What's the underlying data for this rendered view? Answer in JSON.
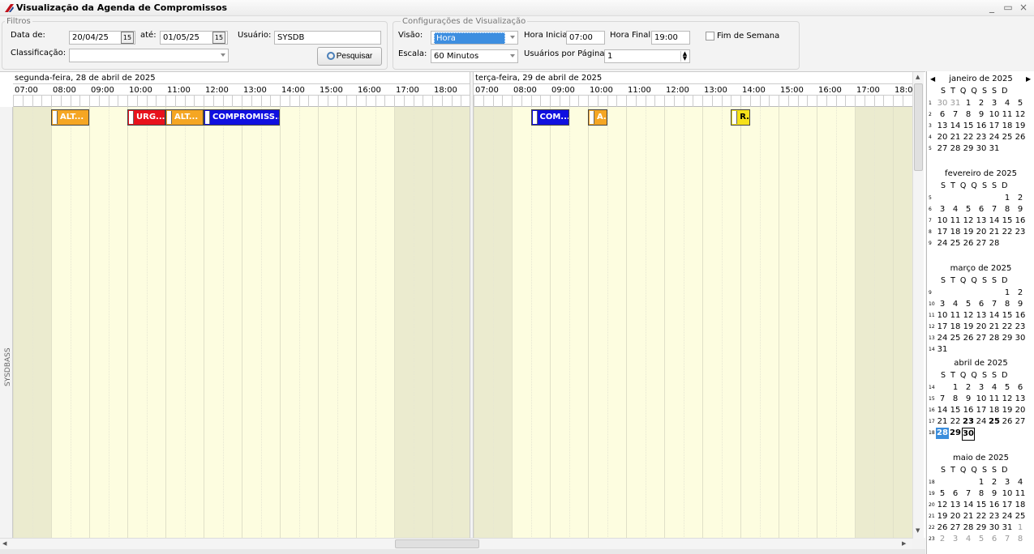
{
  "window": {
    "title": "Visualização da Agenda de Compromissos",
    "min": "_",
    "max": "▭",
    "close": "×"
  },
  "filters": {
    "legend": "Filtros",
    "date_from_label": "Data de:",
    "date_from": "20/04/25",
    "date_to_label": "até:",
    "date_to": "01/05/25",
    "user_label": "Usuário:",
    "user": "SYSDB",
    "class_label": "Classificação:",
    "class_value": "",
    "search_label": "Pesquisar",
    "cal_glyph": "15"
  },
  "view_config": {
    "legend": "Configurações de Visualização",
    "view_label": "Visão:",
    "view_value": "Hora",
    "scale_label": "Escala:",
    "scale_value": "60 Minutos",
    "start_label": "Hora Inicial",
    "start_value": "07:00",
    "end_label": "Hora Final",
    "end_value": "19:00",
    "users_per_page_label": "Usuários por Página",
    "users_per_page_value": "1",
    "weekend_label": "Fim de Semana"
  },
  "scheduler": {
    "resource": "SYSDBASS",
    "hours": [
      "07:00",
      "08:00",
      "09:00",
      "10:00",
      "11:00",
      "12:00",
      "13:00",
      "14:00",
      "15:00",
      "16:00",
      "17:00",
      "18:00"
    ],
    "day2_last_hour": "18:0",
    "days": [
      {
        "label": "segunda-feira, 28 de abril de 2025",
        "appointments": [
          {
            "text": "ALT...",
            "start": 8.0,
            "end": 9.0,
            "color": "#f5a623"
          },
          {
            "text": "URG...",
            "start": 10.0,
            "end": 11.0,
            "color": "#e8121c"
          },
          {
            "text": "ALT...",
            "start": 11.0,
            "end": 12.0,
            "color": "#f5a623"
          },
          {
            "text": "COMPROMISS...",
            "start": 12.0,
            "end": 14.0,
            "color": "#1010e0"
          }
        ]
      },
      {
        "label": "terça-feira, 29 de abril de 2025",
        "appointments": [
          {
            "text": "COM...",
            "start": 8.5,
            "end": 9.5,
            "color": "#1010e0"
          },
          {
            "text": "A.",
            "start": 10.0,
            "end": 10.5,
            "color": "#f5a623"
          },
          {
            "text": "R.",
            "start": 13.75,
            "end": 14.25,
            "color": "#f6e11a"
          }
        ]
      }
    ]
  },
  "calendar": {
    "nav_prev": "◀",
    "nav_next": "▶",
    "weekday_header": "S  T  Q  Q  S  S  D",
    "months": [
      {
        "title": "janeiro de 2025",
        "weeks": [
          {
            "n": "1",
            "d": [
              "30",
              "31",
              "1",
              "2",
              "3",
              "4",
              "5"
            ],
            "o": [
              0,
              1
            ]
          },
          {
            "n": "2",
            "d": [
              "6",
              "7",
              "8",
              "9",
              "10",
              "11",
              "12"
            ]
          },
          {
            "n": "3",
            "d": [
              "13",
              "14",
              "15",
              "16",
              "17",
              "18",
              "19"
            ]
          },
          {
            "n": "4",
            "d": [
              "20",
              "21",
              "22",
              "23",
              "24",
              "25",
              "26"
            ]
          },
          {
            "n": "5",
            "d": [
              "27",
              "28",
              "29",
              "30",
              "31",
              "",
              ""
            ]
          }
        ]
      },
      {
        "title": "fevereiro de 2025",
        "weeks": [
          {
            "n": "5",
            "d": [
              "",
              "",
              "",
              "",
              "",
              "1",
              "2"
            ]
          },
          {
            "n": "6",
            "d": [
              "3",
              "4",
              "5",
              "6",
              "7",
              "8",
              "9"
            ]
          },
          {
            "n": "7",
            "d": [
              "10",
              "11",
              "12",
              "13",
              "14",
              "15",
              "16"
            ]
          },
          {
            "n": "8",
            "d": [
              "17",
              "18",
              "19",
              "20",
              "21",
              "22",
              "23"
            ]
          },
          {
            "n": "9",
            "d": [
              "24",
              "25",
              "26",
              "27",
              "28",
              "",
              ""
            ]
          }
        ]
      },
      {
        "title": "março de 2025",
        "weeks": [
          {
            "n": "9",
            "d": [
              "",
              "",
              "",
              "",
              "",
              "1",
              "2"
            ]
          },
          {
            "n": "10",
            "d": [
              "3",
              "4",
              "5",
              "6",
              "7",
              "8",
              "9"
            ]
          },
          {
            "n": "11",
            "d": [
              "10",
              "11",
              "12",
              "13",
              "14",
              "15",
              "16"
            ]
          },
          {
            "n": "12",
            "d": [
              "17",
              "18",
              "19",
              "20",
              "21",
              "22",
              "23"
            ]
          },
          {
            "n": "13",
            "d": [
              "24",
              "25",
              "26",
              "27",
              "28",
              "29",
              "30"
            ]
          },
          {
            "n": "14",
            "d": [
              "31",
              "",
              "",
              "",
              "",
              "",
              ""
            ]
          }
        ]
      },
      {
        "title": "abril de 2025",
        "weeks": [
          {
            "n": "14",
            "d": [
              "",
              "1",
              "2",
              "3",
              "4",
              "5",
              "6"
            ]
          },
          {
            "n": "15",
            "d": [
              "7",
              "8",
              "9",
              "10",
              "11",
              "12",
              "13"
            ]
          },
          {
            "n": "16",
            "d": [
              "14",
              "15",
              "16",
              "17",
              "18",
              "19",
              "20"
            ]
          },
          {
            "n": "17",
            "d": [
              "21",
              "22",
              "23",
              "24",
              "25",
              "26",
              "27"
            ],
            "b": [
              2,
              4
            ]
          },
          {
            "n": "18",
            "d": [
              "28",
              "29",
              "30",
              "",
              "",
              "",
              ""
            ],
            "t": [
              0
            ],
            "b": [
              1
            ],
            "s": [
              2
            ]
          }
        ]
      },
      {
        "title": "maio de 2025",
        "weeks": [
          {
            "n": "18",
            "d": [
              "",
              "",
              "",
              "1",
              "2",
              "3",
              "4"
            ]
          },
          {
            "n": "19",
            "d": [
              "5",
              "6",
              "7",
              "8",
              "9",
              "10",
              "11"
            ]
          },
          {
            "n": "20",
            "d": [
              "12",
              "13",
              "14",
              "15",
              "16",
              "17",
              "18"
            ]
          },
          {
            "n": "21",
            "d": [
              "19",
              "20",
              "21",
              "22",
              "23",
              "24",
              "25"
            ]
          },
          {
            "n": "22",
            "d": [
              "26",
              "27",
              "28",
              "29",
              "30",
              "31",
              "1"
            ],
            "o": [
              6
            ]
          },
          {
            "n": "23",
            "d": [
              "2",
              "3",
              "4",
              "5",
              "6",
              "7",
              "8"
            ],
            "o": [
              0,
              1,
              2,
              3,
              4,
              5,
              6
            ]
          }
        ]
      }
    ]
  }
}
